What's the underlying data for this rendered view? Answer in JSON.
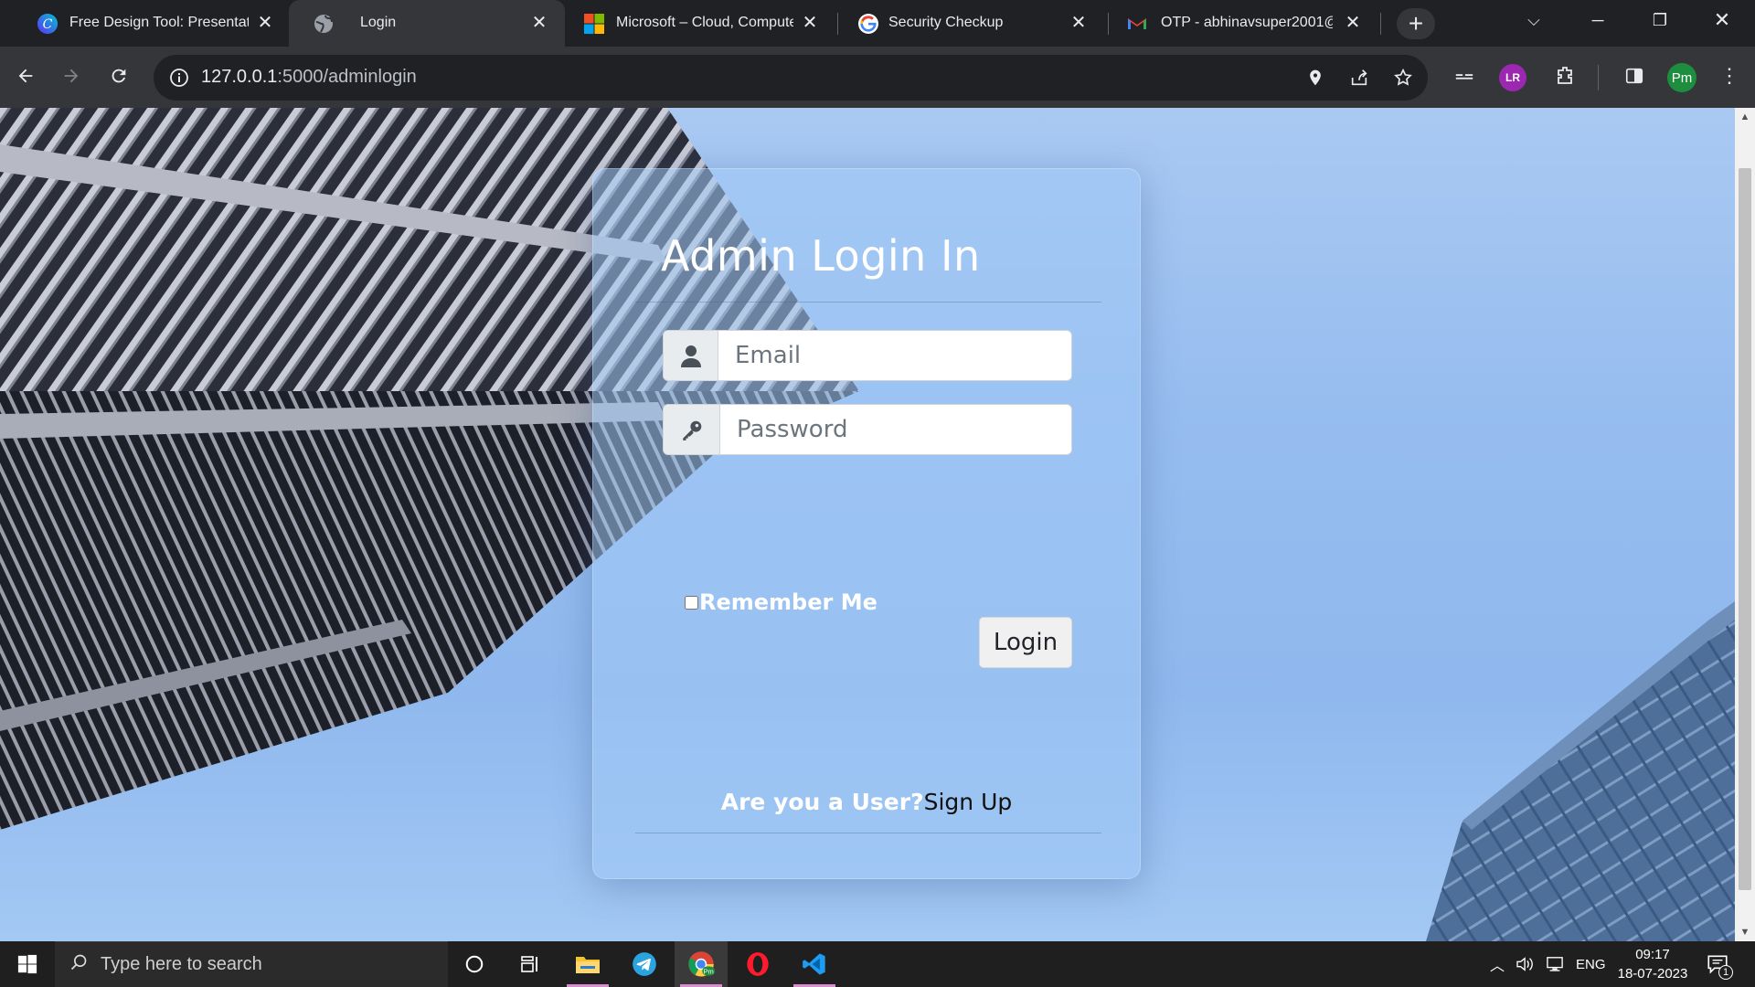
{
  "browser": {
    "tabs": [
      {
        "title": "Free Design Tool: Presentatio",
        "icon": "canva-icon",
        "active": false
      },
      {
        "title": "Login",
        "icon": "globe-icon",
        "active": true
      },
      {
        "title": "Microsoft – Cloud, Computer",
        "icon": "microsoft-icon",
        "active": false
      },
      {
        "title": "Security Checkup",
        "icon": "google-icon",
        "active": false
      },
      {
        "title": "OTP - abhinavsuper2001@gr",
        "icon": "gmail-icon",
        "active": false
      }
    ],
    "url_host": "127.0.0.1",
    "url_path": ":5000/adminlogin",
    "profile_initials": "Pm",
    "extension_initials": "LR"
  },
  "login": {
    "title": "Admin Login In",
    "email_placeholder": "Email",
    "password_placeholder": "Password",
    "remember_label": "Remember Me",
    "login_button": "Login",
    "signup_question": "Are you a User?",
    "signup_link": "Sign Up"
  },
  "taskbar": {
    "search_placeholder": "Type here to search",
    "language": "ENG",
    "time": "09:17",
    "date": "18-07-2023",
    "notification_count": "1"
  },
  "colors": {
    "sky": "#97bdef",
    "card": "rgba(160,200,245,0.55)",
    "tab_active": "#35363a",
    "taskbar": "#1f1f1f"
  }
}
